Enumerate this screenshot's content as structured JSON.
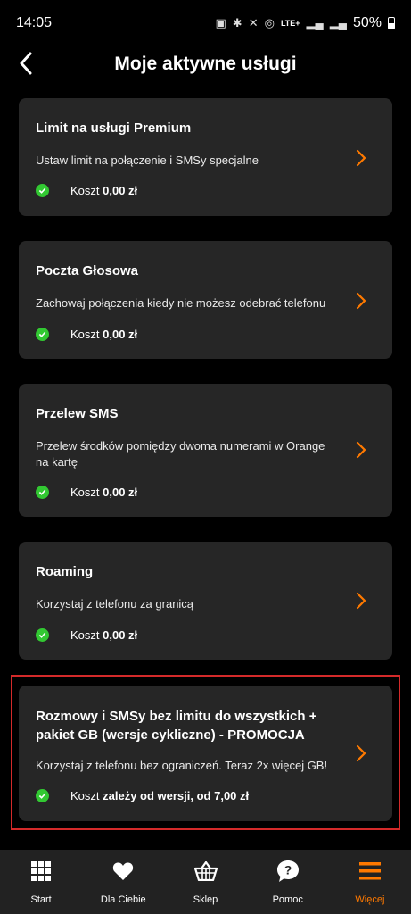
{
  "status_bar": {
    "time": "14:05",
    "network": "LTE+",
    "battery": "50%"
  },
  "header": {
    "title": "Moje aktywne usługi"
  },
  "services": [
    {
      "title": "Limit na usługi Premium",
      "description": "Ustaw limit na połączenie i SMSy specjalne",
      "cost_label": "Koszt ",
      "cost_value": "0,00 zł"
    },
    {
      "title": "Poczta Głosowa",
      "description": "Zachowaj połączenia kiedy nie możesz odebrać telefonu",
      "cost_label": "Koszt ",
      "cost_value": "0,00 zł"
    },
    {
      "title": "Przelew SMS",
      "description": "Przelew środków pomiędzy dwoma numerami w Orange na kartę",
      "cost_label": "Koszt ",
      "cost_value": "0,00 zł"
    },
    {
      "title": "Roaming",
      "description": "Korzystaj z telefonu za granicą",
      "cost_label": "Koszt ",
      "cost_value": "0,00 zł"
    },
    {
      "title": "Rozmowy i SMSy bez limitu do wszystkich + pakiet GB (wersje cykliczne) - PROMOCJA",
      "description": "Korzystaj z telefonu bez ograniczeń. Teraz 2x więcej GB!",
      "cost_label": "Koszt ",
      "cost_value": "zależy od wersji, od 7,00 zł"
    }
  ],
  "bottom_nav": [
    {
      "label": "Start",
      "icon": "grid-icon"
    },
    {
      "label": "Dla Ciebie",
      "icon": "heart-icon"
    },
    {
      "label": "Sklep",
      "icon": "basket-icon"
    },
    {
      "label": "Pomoc",
      "icon": "help-bubble-icon"
    },
    {
      "label": "Więcej",
      "icon": "menu-icon",
      "active": true
    }
  ],
  "colors": {
    "accent": "#ff7900",
    "card_bg": "#262626",
    "check": "#32c832",
    "highlight": "#d42a2a",
    "nav_bg": "#222222"
  }
}
